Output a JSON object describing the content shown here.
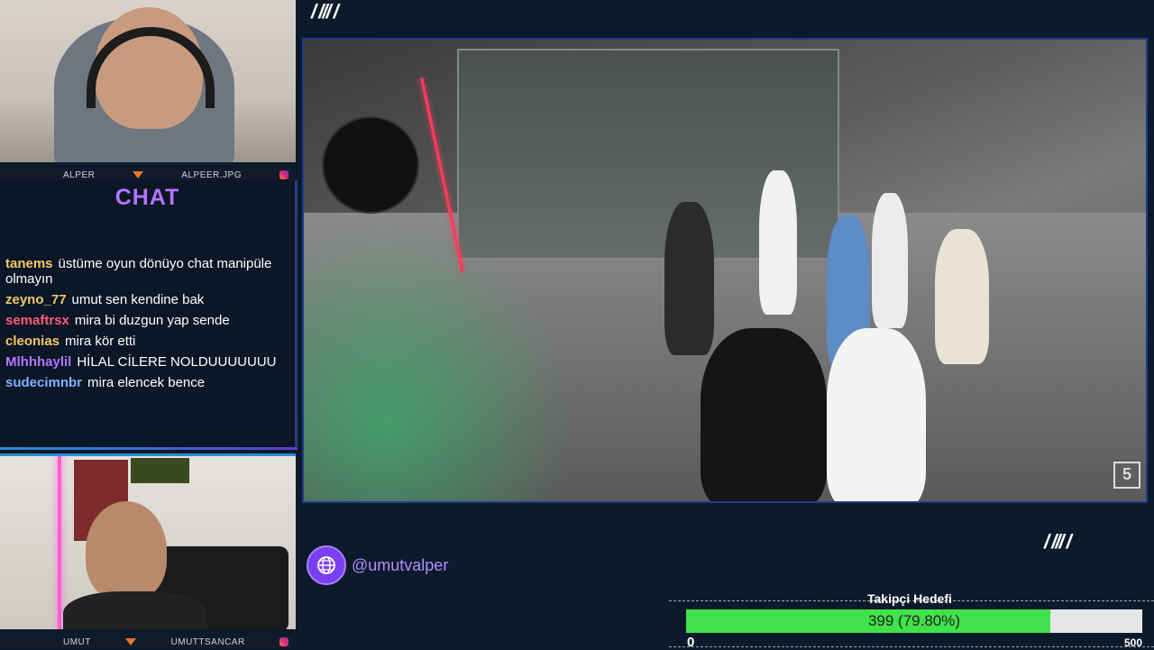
{
  "top_cam": {
    "left_label": "ALPER",
    "right_label": "ALPEER.JPG"
  },
  "chat": {
    "title": "CHAT",
    "messages": [
      {
        "user": "tanems",
        "color": "#f4c867",
        "text": "üstüme oyun dönüyo chat manipüle olmayın"
      },
      {
        "user": "zeyno_77",
        "color": "#f4c867",
        "text": "umut sen kendine bak"
      },
      {
        "user": "semaftrsx",
        "color": "#ff5b7a",
        "text": "mira bi duzgun yap sende"
      },
      {
        "user": "cleonias",
        "color": "#f4c867",
        "text": "mira kör etti"
      },
      {
        "user": "Mlhhhaylil",
        "color": "#b574ff",
        "text": "HİLAL CİLERE NOLDUUUUUUU"
      },
      {
        "user": "sudecimnbr",
        "color": "#7fb2ff",
        "text": "mira elencek bence"
      }
    ]
  },
  "bottom_cam": {
    "left_label": "UMUT",
    "right_label": "UMUTTSANCAR"
  },
  "video": {
    "channel_logo": "5"
  },
  "decor": {
    "slashes": "/ /// /"
  },
  "social": {
    "handle": "@umutvalper",
    "icon": "globe-icon"
  },
  "follower_goal": {
    "title": "Takipçi Hedefi",
    "label": "399 (79.80%)",
    "current": 399,
    "goal": 500,
    "fraction": 0.798,
    "min_label": "0",
    "max_label": "500"
  }
}
